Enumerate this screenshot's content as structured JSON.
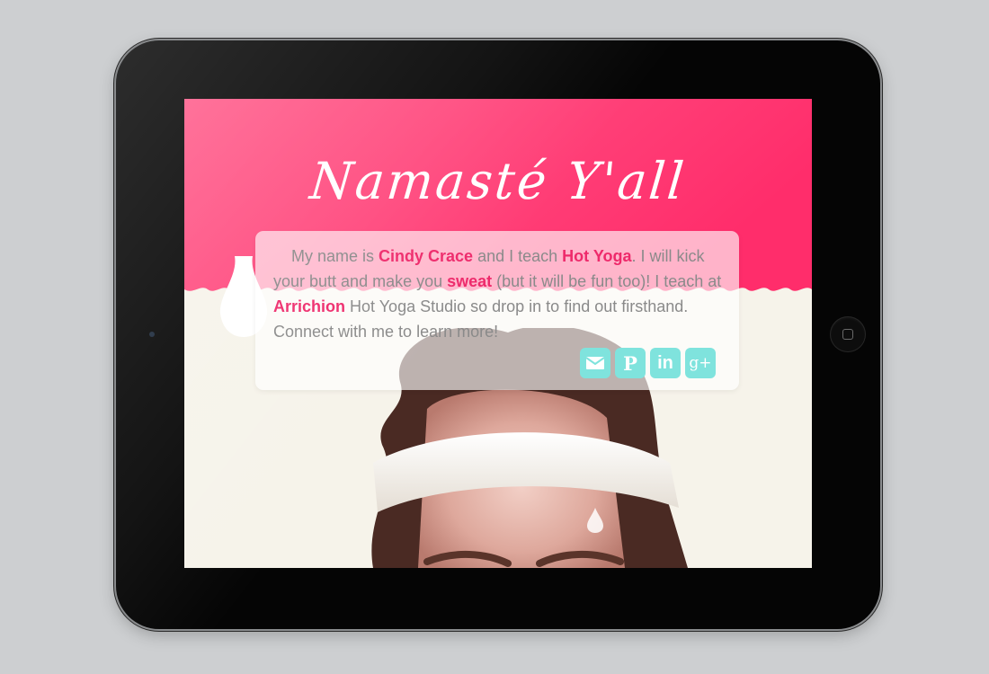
{
  "page": {
    "title": "Namasté Y'all"
  },
  "bio": {
    "part1": "My name is ",
    "name": "Cindy Crace",
    "part2": " and I teach ",
    "discipline": "Hot Yoga",
    "part3": ".  I will kick your butt and make you ",
    "sweat": "sweat",
    "part4": " (but it will be fun too)!  I teach at ",
    "studio": "Arrichion",
    "part5": " Hot Yoga Studio so drop in to find out firsthand.  Connect with me to learn more!"
  },
  "social": {
    "items": [
      {
        "name": "email",
        "icon": "envelope-icon",
        "glyph": "✉"
      },
      {
        "name": "pinterest",
        "icon": "pinterest-icon",
        "glyph": "P"
      },
      {
        "name": "linkedin",
        "icon": "linkedin-icon",
        "glyph": "in"
      },
      {
        "name": "google-plus",
        "icon": "google-plus-icon",
        "glyph": "g+"
      }
    ]
  },
  "colors": {
    "accent_pink": "#ee2a6b",
    "hero_pink_start": "#ff5d8b",
    "hero_pink_end": "#ff2d6b",
    "social_teal": "#7fe3dd",
    "text_gray": "#8a8a8a",
    "page_cream": "#f6f3ea",
    "background": "#cdcfd1",
    "device_body": "#050505"
  }
}
